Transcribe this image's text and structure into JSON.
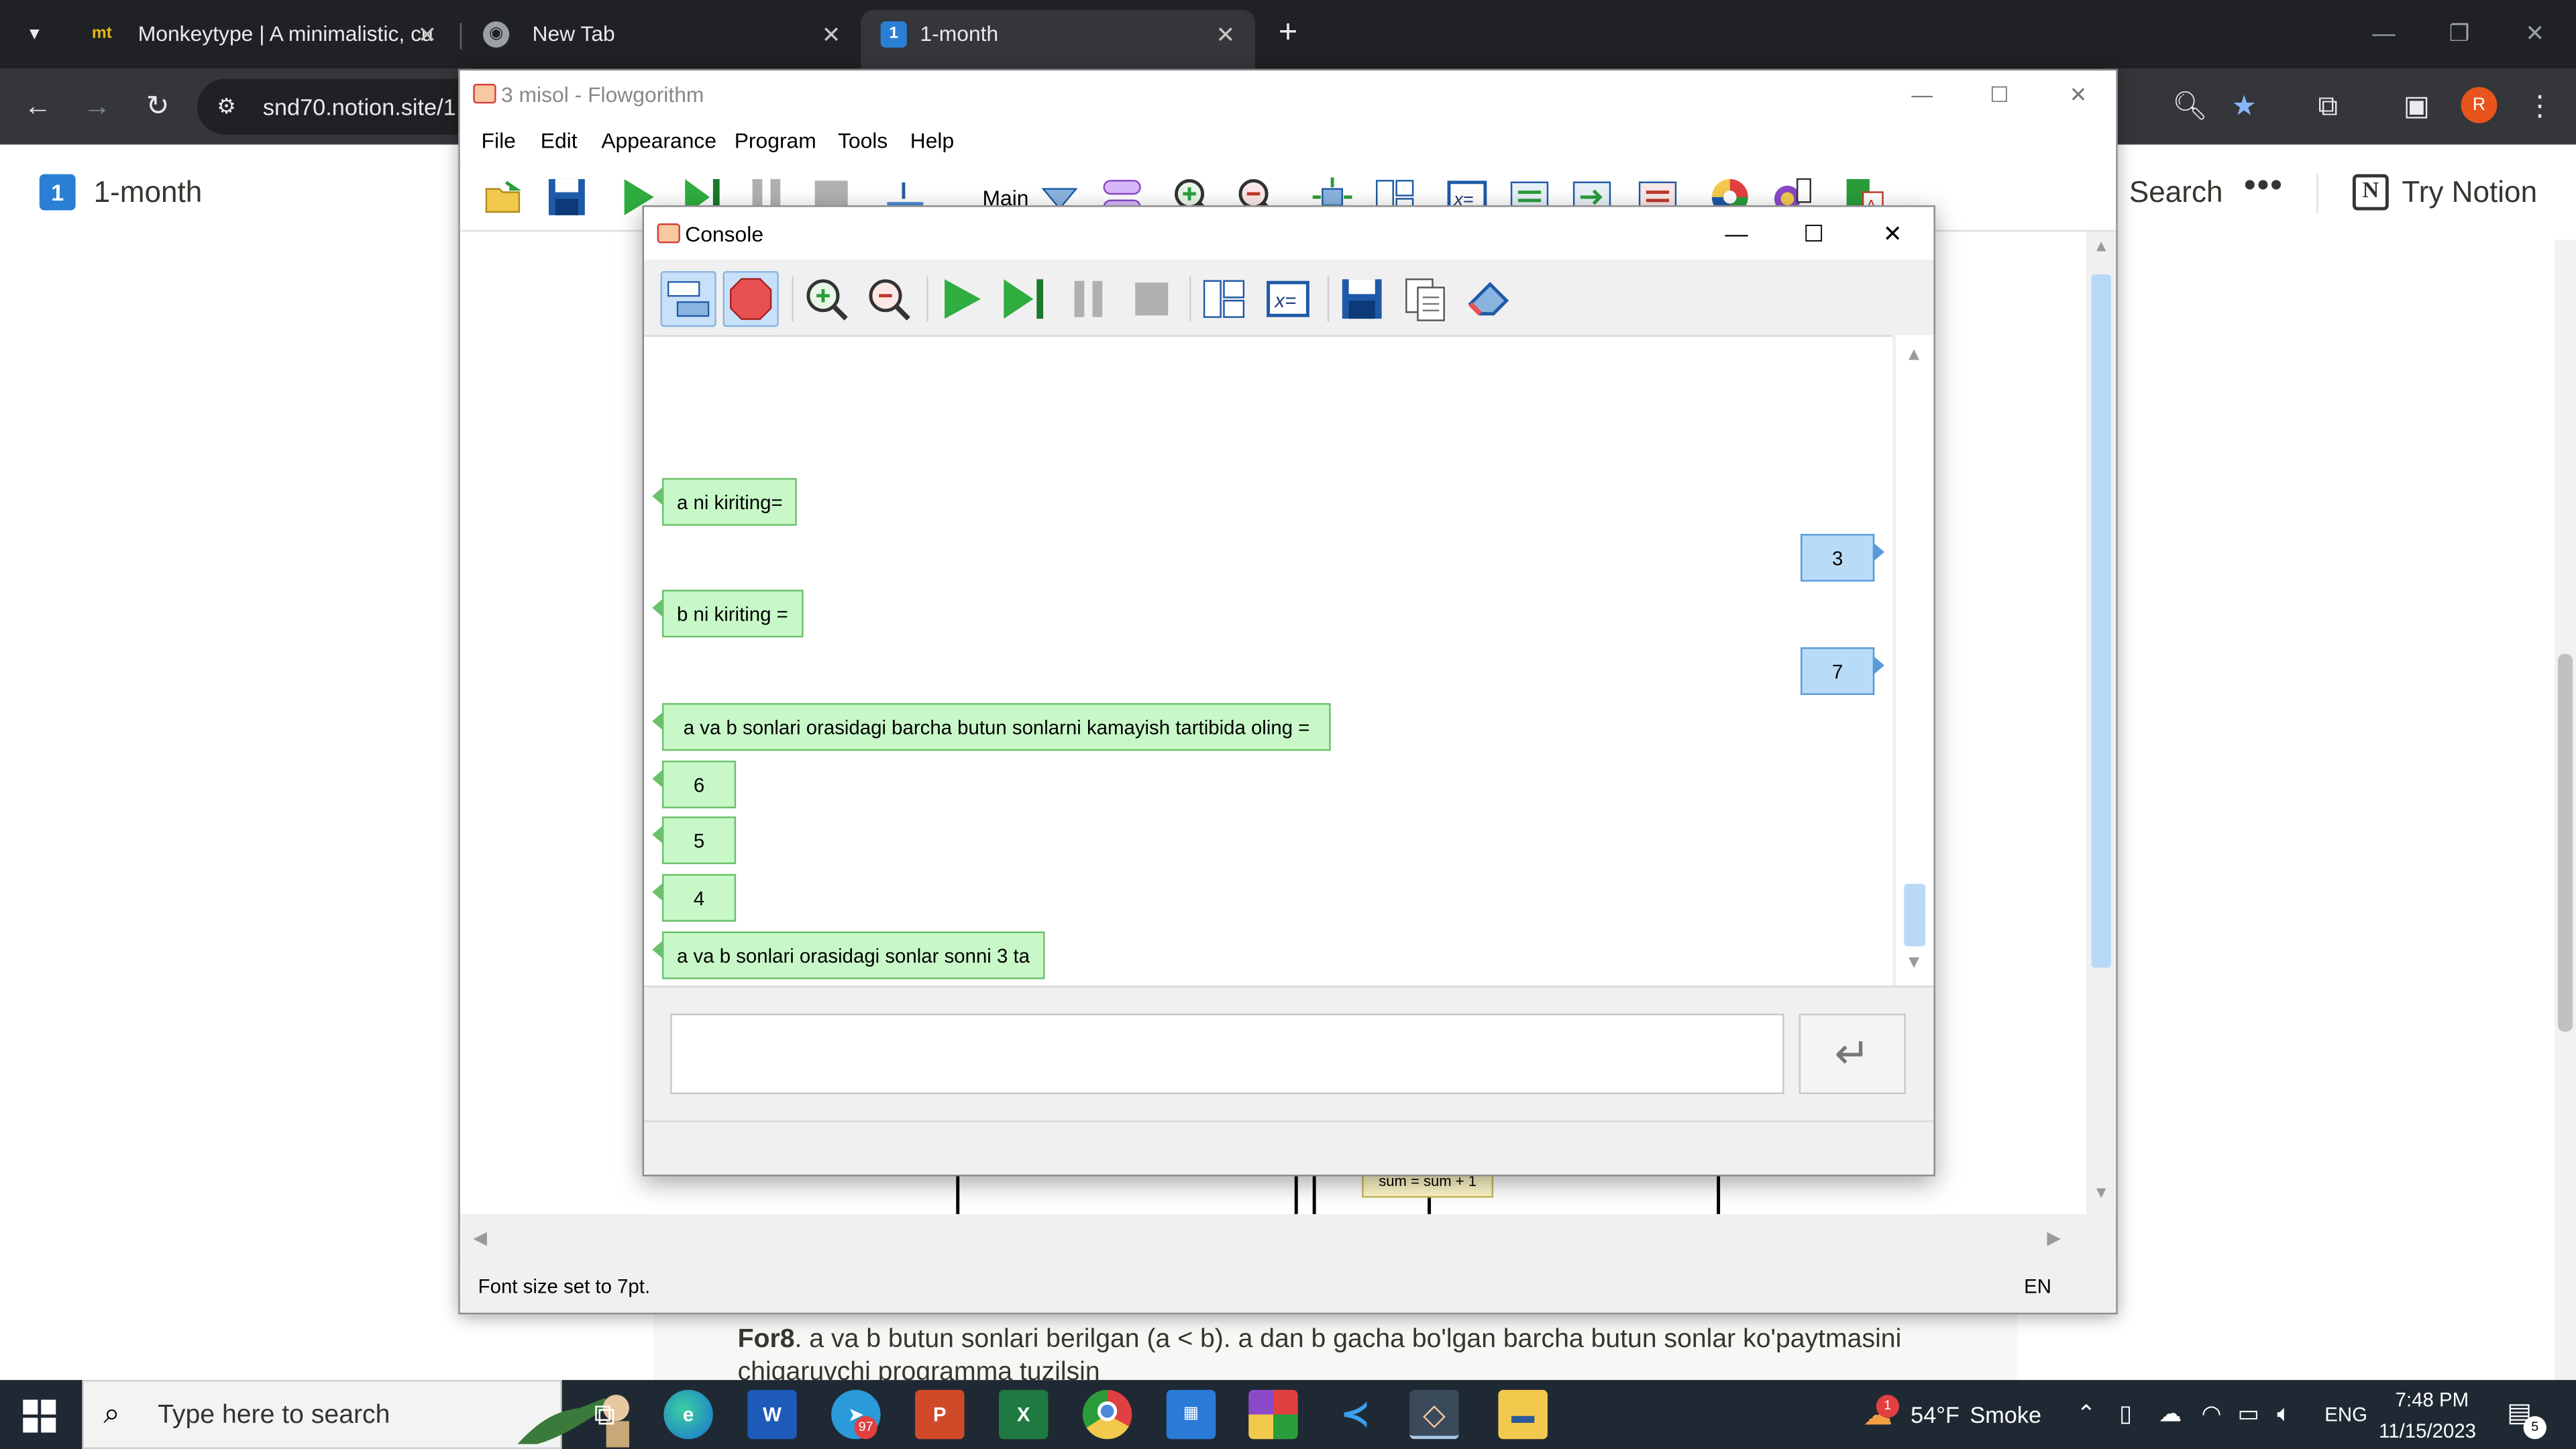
{
  "browser": {
    "tabs": [
      {
        "label": "Monkeytype | A minimalistic, cu",
        "favicon": "mt"
      },
      {
        "label": "New Tab",
        "favicon": "chrome-icon"
      },
      {
        "label": "1-month",
        "favicon": "notion-page-icon"
      }
    ],
    "address": "snd70.notion.site/1",
    "profile_initial": "R"
  },
  "notion": {
    "page_icon": "1",
    "page_title": "1-month",
    "search_label": "Search",
    "more_label": "•••",
    "try_label": "Try Notion",
    "body_bold": "For8",
    "body_text": ". a va b butun sonlari berilgan (a < b). a dan b gacha bo'lgan barcha butun sonlar ko'paytmasini chiqaruvchi programma tuzilsin"
  },
  "flowgorithm": {
    "title": "3 misol - Flowgorithm",
    "menu": [
      "File",
      "Edit",
      "Appearance",
      "Program",
      "Tools",
      "Help"
    ],
    "function_selector": "Main",
    "status_message": "Font size set to 7pt.",
    "status_lang": "EN",
    "canvas_box_label": "sum = sum + 1"
  },
  "console": {
    "title": "Console",
    "messages": [
      {
        "type": "output",
        "text": "a ni kiriting="
      },
      {
        "type": "input",
        "text": "3"
      },
      {
        "type": "output",
        "text": "b ni kiriting ="
      },
      {
        "type": "input",
        "text": "7"
      },
      {
        "type": "output",
        "text": "a va b sonlari orasidagi barcha butun sonlarni kamayish tartibida oling ="
      },
      {
        "type": "output",
        "text": "6"
      },
      {
        "type": "output",
        "text": "5"
      },
      {
        "type": "output",
        "text": "4"
      },
      {
        "type": "output",
        "text": "a va b sonlari orasidagi sonlar sonni 3 ta"
      }
    ],
    "input_value": "",
    "enter_symbol": "↵"
  },
  "taskbar": {
    "search_placeholder": "Type here to search",
    "telegram_badge": "97",
    "weather_temp": "54°F",
    "weather_desc": "Smoke",
    "weather_badge": "1",
    "language": "ENG",
    "time": "7:48 PM",
    "date": "11/15/2023",
    "notification_count": "5"
  }
}
